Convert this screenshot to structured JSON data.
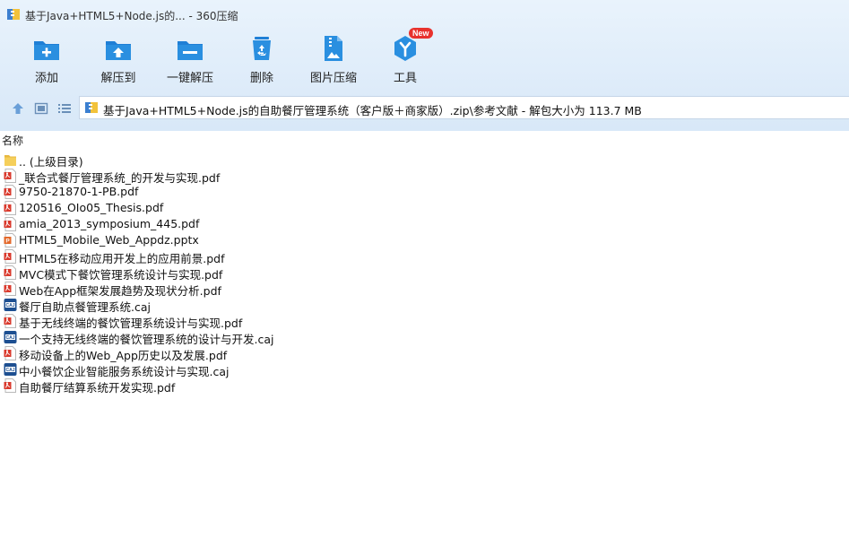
{
  "window": {
    "doc_title": "基于Java+HTML5+Node.js的...",
    "separator": " - ",
    "app_name": "360压缩"
  },
  "toolbar": {
    "add": "添加",
    "extract_to": "解压到",
    "one_click_extract": "一键解压",
    "delete": "删除",
    "image_compress": "图片压缩",
    "tools": "工具",
    "tools_badge": "New"
  },
  "addressbar": {
    "path": "基于Java+HTML5+Node.js的自助餐厅管理系统（客户版＋商家版）.zip\\参考文献 - 解包大小为 113.7 MB"
  },
  "filelist": {
    "column_name": "名称",
    "items": [
      {
        "name": ".. (上级目录)",
        "type": "folder"
      },
      {
        "name": "_联合式餐厅管理系统_的开发与实现.pdf",
        "type": "pdf"
      },
      {
        "name": "9750-21870-1-PB.pdf",
        "type": "pdf"
      },
      {
        "name": "120516_OIo05_Thesis.pdf",
        "type": "pdf"
      },
      {
        "name": "amia_2013_symposium_445.pdf",
        "type": "pdf"
      },
      {
        "name": "HTML5_Mobile_Web_Appdz.pptx",
        "type": "pptx"
      },
      {
        "name": "HTML5在移动应用开发上的应用前景.pdf",
        "type": "pdf"
      },
      {
        "name": "MVC模式下餐饮管理系统设计与实现.pdf",
        "type": "pdf"
      },
      {
        "name": "Web在App框架发展趋势及现状分析.pdf",
        "type": "pdf"
      },
      {
        "name": "餐厅自助点餐管理系统.caj",
        "type": "caj"
      },
      {
        "name": "基于无线终端的餐饮管理系统设计与实现.pdf",
        "type": "pdf"
      },
      {
        "name": "一个支持无线终端的餐饮管理系统的设计与开发.caj",
        "type": "caj"
      },
      {
        "name": "移动设备上的Web_App历史以及发展.pdf",
        "type": "pdf"
      },
      {
        "name": "中小餐饮企业智能服务系统设计与实现.caj",
        "type": "caj"
      },
      {
        "name": "自助餐厅结算系统开发实现.pdf",
        "type": "pdf"
      }
    ]
  },
  "colors": {
    "accent": "#2a8fe0",
    "pdf_red": "#d9392c",
    "pptx_orange": "#e3682a",
    "caj_navy": "#1d4f91",
    "folder_yellow": "#f5cf5b"
  },
  "icons": {
    "pdf": "pdf-file-icon",
    "pptx": "pptx-file-icon",
    "caj": "caj-file-icon",
    "folder": "folder-icon"
  }
}
